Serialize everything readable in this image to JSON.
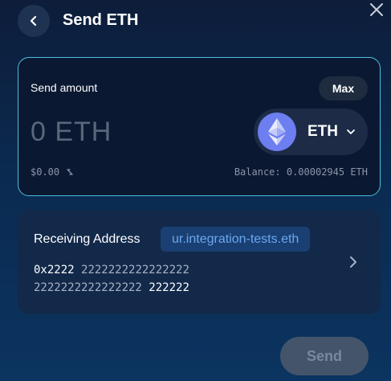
{
  "header": {
    "title": "Send ETH"
  },
  "amount": {
    "label": "Send amount",
    "max_label": "Max",
    "input_value": "0 ETH",
    "usd_value": "$0.00",
    "balance": "Balance: 0.00002945 ETH"
  },
  "token": {
    "symbol": "ETH",
    "icon": "ethereum-icon"
  },
  "receiving": {
    "label": "Receiving Address",
    "ens_name": "ur.integration-tests.eth",
    "address_line1_prefix": "0x2222",
    "address_line1_middle": "2222222222222222",
    "address_line2_middle": "2222222222222222",
    "address_line2_suffix": "222222"
  },
  "actions": {
    "send_label": "Send"
  },
  "colors": {
    "accent_border": "#4cc0de",
    "eth_purple": "#6c7ef0",
    "ens_text": "#6ca8ee"
  }
}
